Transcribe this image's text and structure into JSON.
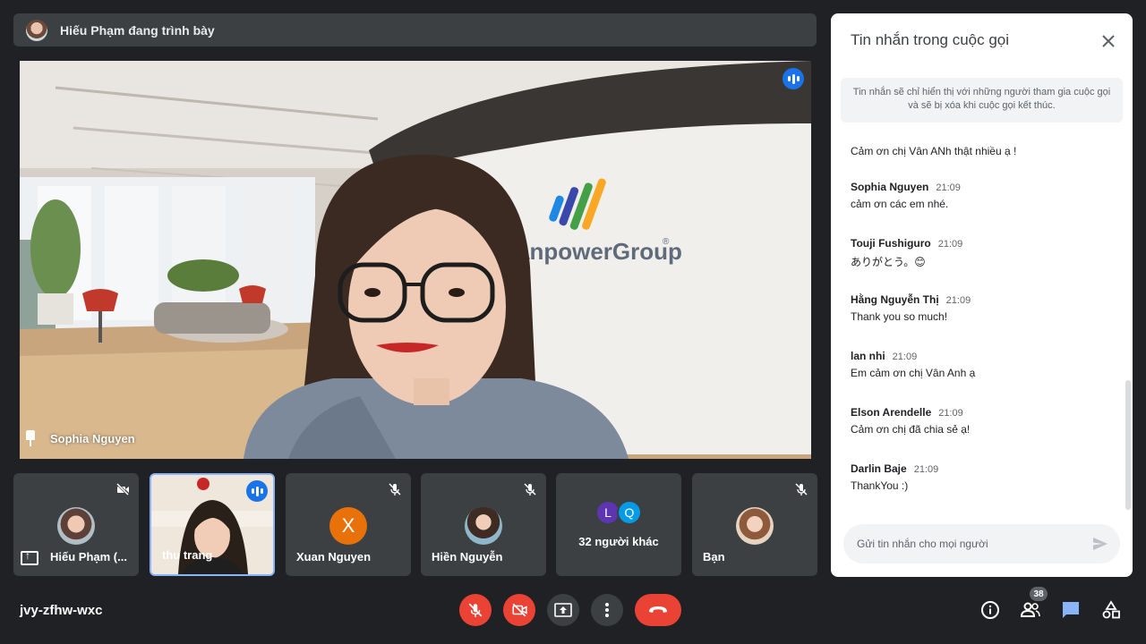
{
  "presenting": {
    "text": "Hiếu Phạm đang trình bày"
  },
  "main_video": {
    "name": "Sophia Nguyen",
    "sign_text": "anpowerGroup",
    "sign_mark": "®"
  },
  "tiles": [
    {
      "name": "Hiếu Phạm (...",
      "icon": "present-to-all-icon"
    },
    {
      "name": "thu trang",
      "icon": "speaking-icon"
    },
    {
      "name": "Xuan Nguyen",
      "letter": "X",
      "icon": "mic-off-icon",
      "avatar_color": "#e8710a"
    },
    {
      "name": "Hiền Nguyễn",
      "icon": "mic-off-icon"
    },
    {
      "label": "32 người khác",
      "avatars": [
        "L",
        "Q"
      ],
      "avatar_colors": [
        "#5e35b1",
        "#039be5"
      ]
    },
    {
      "name": "Bạn",
      "icon": "mic-off-icon"
    }
  ],
  "bottom_bar": {
    "meeting_code": "jvy-zfhw-wxc",
    "people_count": "38"
  },
  "chat": {
    "title": "Tin nhắn trong cuộc gọi",
    "notice": "Tin nhắn sẽ chỉ hiển thị với những người tham gia cuộc gọi và sẽ bị xóa khi cuộc gọi kết thúc.",
    "partial_message": {
      "text": "Cảm ơn chị Vân ANh thật nhiều ạ !"
    },
    "messages": [
      {
        "sender": "Sophia Nguyen",
        "time": "21:09",
        "text": "cảm ơn các em nhé."
      },
      {
        "sender": "Touji Fushiguro",
        "time": "21:09",
        "text": "ありがとう。😊"
      },
      {
        "sender": "Hằng Nguyễn Thị",
        "time": "21:09",
        "text": "Thank you so much!"
      },
      {
        "sender": "lan nhi",
        "time": "21:09",
        "text": "Em cảm ơn chị Vân Anh ạ"
      },
      {
        "sender": "Elson Arendelle",
        "time": "21:09",
        "text": "Cảm ơn chị đã chia sẻ ạ!"
      },
      {
        "sender": "Darlin Baje",
        "time": "21:09",
        "text": "ThankYou :)"
      }
    ],
    "input_placeholder": "Gửi tin nhắn cho mọi người"
  },
  "colors": {
    "accent": "#1a73e8",
    "danger": "#ea4335",
    "background": "#202124",
    "tile": "#3c4043"
  }
}
